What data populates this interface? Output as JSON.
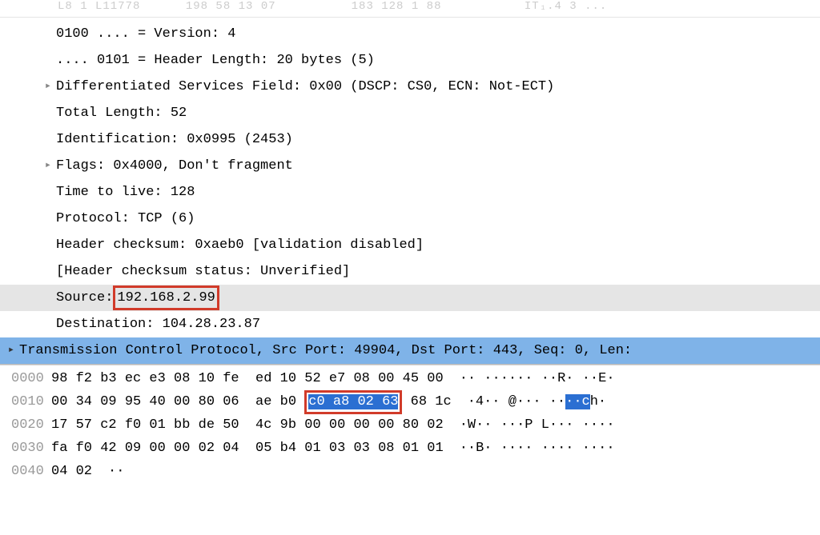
{
  "faded": "L8 1 L11778      198 58 13 07          183 128 1 88           IT₁.4 3 ...",
  "tree": {
    "version": "0100 .... = Version: 4",
    "header_length": ".... 0101 = Header Length: 20 bytes (5)",
    "dsf": "Differentiated Services Field: 0x00 (DSCP: CS0, ECN: Not-ECT)",
    "total_length": "Total Length: 52",
    "identification": "Identification: 0x0995 (2453)",
    "flags": "Flags: 0x4000, Don't fragment",
    "ttl": "Time to live: 128",
    "protocol": "Protocol: TCP (6)",
    "checksum": "Header checksum: 0xaeb0 [validation disabled]",
    "checksum_status": "[Header checksum status: Unverified]",
    "source_label": "Source:",
    "source_ip": " 192.168.2.99 ",
    "destination": "Destination: 104.28.23.87",
    "tcp": "Transmission Control Protocol, Src Port: 49904, Dst Port: 443, Seq: 0, Len:"
  },
  "hex": {
    "rows": [
      {
        "offset": "0000",
        "a": "98 f2 b3 ec e3 08 10 fe  ",
        "b": "ed 10 52 e7 08 00 45 00",
        "ascii": "·· ······ ··R· ··E·"
      },
      {
        "offset": "0010",
        "a": "00 34 09 95 40 00 80 06  ",
        "b_pre": "ae b0 ",
        "b_hl": "c0 a8 02 63",
        "b_post": " 68 1c",
        "ascii_pre": "·4·· @··· ··",
        "ascii_hl": "··c",
        "ascii_post": "h·"
      },
      {
        "offset": "0020",
        "a": "17 57 c2 f0 01 bb de 50  ",
        "b": "4c 9b 00 00 00 00 80 02",
        "ascii": "·W·· ···P L··· ····"
      },
      {
        "offset": "0030",
        "a": "fa f0 42 09 00 00 02 04  ",
        "b": "05 b4 01 03 03 08 01 01",
        "ascii": "··B· ···· ···· ····"
      },
      {
        "offset": "0040",
        "a": "04 02",
        "b": "",
        "ascii": "··"
      }
    ]
  }
}
